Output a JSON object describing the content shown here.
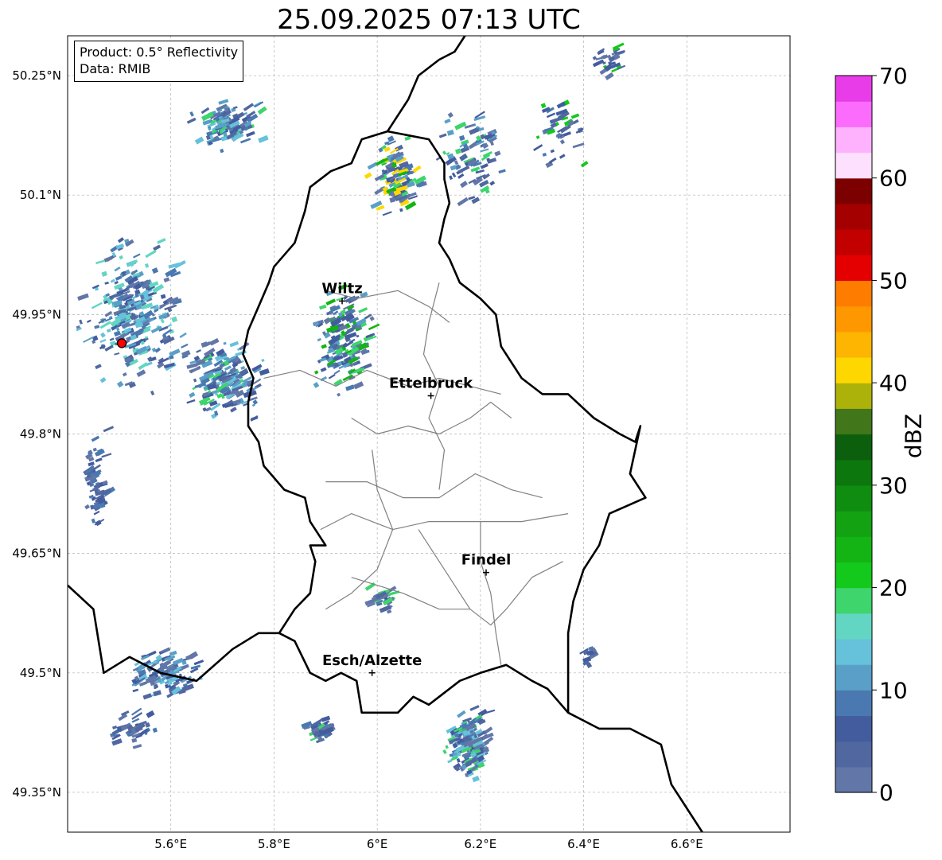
{
  "title": "25.09.2025 07:13 UTC",
  "info": {
    "product": "Product: 0.5° Reflectivity",
    "data": "Data: RMIB"
  },
  "map": {
    "lon_range": [
      5.4,
      6.8
    ],
    "lat_range": [
      49.3,
      50.3
    ],
    "lon_ticks": [
      {
        "value": 5.6,
        "label": "5.6°E"
      },
      {
        "value": 5.8,
        "label": "5.8°E"
      },
      {
        "value": 6.0,
        "label": "6°E"
      },
      {
        "value": 6.2,
        "label": "6.2°E"
      },
      {
        "value": 6.4,
        "label": "6.4°E"
      },
      {
        "value": 6.6,
        "label": "6.6°E"
      }
    ],
    "lat_ticks": [
      {
        "value": 49.35,
        "label": "49.35°N"
      },
      {
        "value": 49.5,
        "label": "49.5°N"
      },
      {
        "value": 49.65,
        "label": "49.65°N"
      },
      {
        "value": 49.8,
        "label": "49.8°N"
      },
      {
        "value": 49.95,
        "label": "49.95°N"
      },
      {
        "value": 50.1,
        "label": "50.1°N"
      },
      {
        "value": 50.25,
        "label": "50.25°N"
      }
    ],
    "radar_site": {
      "lon": 5.505,
      "lat": 49.914
    },
    "cities": [
      {
        "name": "Wiltz",
        "lon": 5.932,
        "lat": 49.967
      },
      {
        "name": "Ettelbruck",
        "lon": 6.104,
        "lat": 49.848
      },
      {
        "name": "Findel",
        "lon": 6.211,
        "lat": 49.626
      },
      {
        "name": "Esch/Alzette",
        "lon": 5.99,
        "lat": 49.5
      }
    ]
  },
  "colorbar": {
    "label": "dBZ",
    "min": 0,
    "max": 70,
    "tick_labels": [
      "0",
      "10",
      "20",
      "30",
      "40",
      "50",
      "60",
      "70"
    ],
    "colors": [
      "#6277a8",
      "#50689f",
      "#435c9e",
      "#4979b0",
      "#5a9fc7",
      "#66c2da",
      "#63d6c3",
      "#3dd56c",
      "#13c91b",
      "#13b414",
      "#12a212",
      "#0f8d10",
      "#0c770d",
      "#0b5f0d",
      "#41761a",
      "#adb20a",
      "#fed700",
      "#fdb501",
      "#fe9700",
      "#fe7c00",
      "#e40000",
      "#c30000",
      "#a40000",
      "#7d0000",
      "#fde0fd",
      "#feb2fe",
      "#fc6cfc",
      "#e83ce8"
    ]
  }
}
